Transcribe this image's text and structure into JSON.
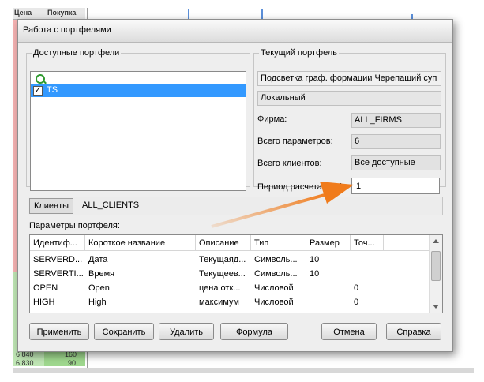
{
  "background": {
    "col1_header": "Цена",
    "col2_header": "Покупка",
    "rows": [
      {
        "price": "6 840",
        "qty": "160"
      },
      {
        "price": "6 830",
        "qty": "90"
      }
    ]
  },
  "dialog": {
    "title": "Работа с портфелями",
    "available": {
      "group_title": "Доступные портфели",
      "search_icon": "search-icon",
      "items": [
        {
          "label": "TS",
          "checked": true,
          "selected": true
        }
      ]
    },
    "current": {
      "group_title": "Текущий портфель",
      "name": "Подсветка граф. формации Черепаший суп",
      "type": "Локальный",
      "firm_label": "Фирма:",
      "firm_value": "ALL_FIRMS",
      "params_label": "Всего параметров:",
      "params_value": "6",
      "clients_label": "Всего клиентов:",
      "clients_value": "Все доступные",
      "period_label": "Период расчета (сек):",
      "period_value": "1"
    },
    "clients_tab": {
      "label": "Клиенты",
      "value": "ALL_CLIENTS"
    },
    "params": {
      "label": "Параметры портфеля:",
      "columns": [
        "Идентиф...",
        "Короткое название",
        "Описание",
        "Тип",
        "Размер",
        "Точ..."
      ],
      "rows": [
        [
          "SERVERD...",
          "Дата",
          "Текущаяд...",
          "Символь...",
          "10",
          ""
        ],
        [
          "SERVERTI...",
          "Время",
          "Текущеев...",
          "Символь...",
          "10",
          ""
        ],
        [
          "OPEN",
          "Open",
          "цена отк...",
          "Числовой",
          "",
          "0"
        ],
        [
          "HIGH",
          "High",
          "максимум",
          "Числовой",
          "",
          "0"
        ]
      ]
    },
    "buttons": {
      "apply": "Применить",
      "save": "Сохранить",
      "delete": "Удалить",
      "formula": "Формула",
      "cancel": "Отмена",
      "help": "Справка"
    },
    "accent_color": "#3399ff",
    "arrow_color": "#f07b1b"
  }
}
